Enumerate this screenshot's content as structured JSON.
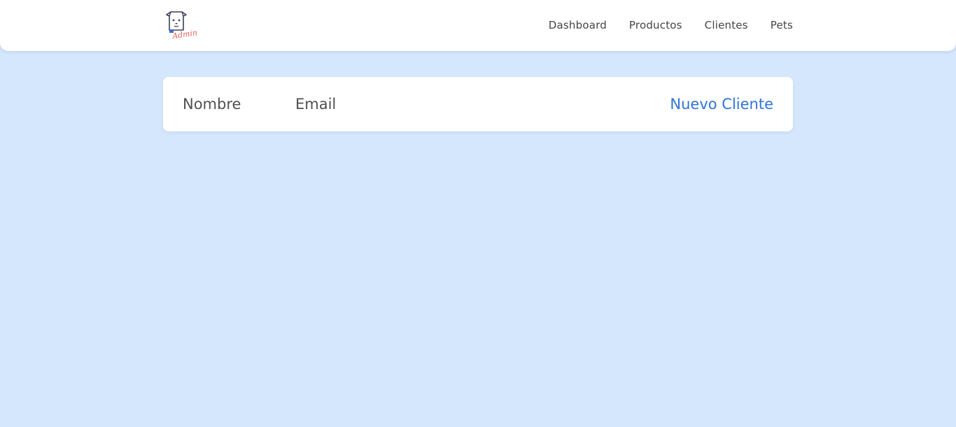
{
  "brand": {
    "logo_icon": "dog-admin-logo-icon",
    "logo_text": "Admin"
  },
  "nav": {
    "items": [
      {
        "label": "Dashboard"
      },
      {
        "label": "Productos"
      },
      {
        "label": "Clientes"
      },
      {
        "label": "Pets"
      }
    ]
  },
  "table": {
    "headers": {
      "nombre": "Nombre",
      "email": "Email"
    },
    "new_client_label": "Nuevo Cliente"
  },
  "colors": {
    "background": "#d4e7fd",
    "link": "#2f74d8",
    "logo_accent": "#e85a5a",
    "logo_blue": "#3a6fd6"
  }
}
